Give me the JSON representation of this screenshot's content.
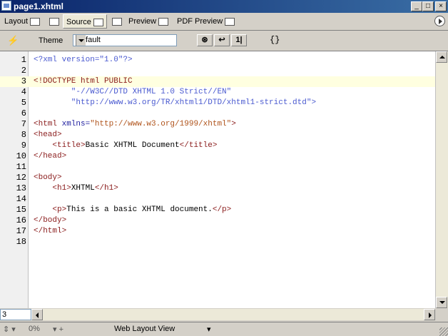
{
  "window": {
    "title": "page1.xhtml",
    "min_label": "_",
    "max_label": "□",
    "close_label": "×"
  },
  "tabs": [
    {
      "label": "Layout"
    },
    {
      "label": ""
    },
    {
      "label": "Source"
    },
    {
      "label": ""
    },
    {
      "label": "Preview"
    },
    {
      "label": "PDF Preview"
    }
  ],
  "toolbar": {
    "lightning_glyph": "⚡",
    "theme_label": "Theme",
    "theme_value": "Default",
    "btn1_glyph": "⊛",
    "btn2_glyph": "↩",
    "btn3_glyph": "1|",
    "braces_glyph": "{}"
  },
  "editor": {
    "highlighted_line": 3,
    "lines": [
      {
        "n": "1",
        "tokens": [
          {
            "t": "<?xml version=\"1.0\"?>",
            "c": "#4a5ad0"
          }
        ]
      },
      {
        "n": "2",
        "tokens": []
      },
      {
        "n": "3",
        "tokens": [
          {
            "t": "<!DOCTYPE html PUBLIC",
            "c": "#8a1c1c"
          }
        ]
      },
      {
        "n": "4",
        "tokens": [
          {
            "t": "        \"-//W3C//DTD XHTML 1.0 Strict//EN\"",
            "c": "#4a5ad0"
          }
        ]
      },
      {
        "n": "5",
        "tokens": [
          {
            "t": "        \"http://www.w3.org/TR/xhtml1/DTD/xhtml1-strict.dtd\">",
            "c": "#4a5ad0"
          }
        ]
      },
      {
        "n": "6",
        "tokens": []
      },
      {
        "n": "7",
        "tokens": [
          {
            "t": "<html ",
            "c": "#8a1c1c"
          },
          {
            "t": "xmlns=",
            "c": "#2020a0"
          },
          {
            "t": "\"http://www.w3.org/1999/xhtml\"",
            "c": "#b0541c"
          },
          {
            "t": ">",
            "c": "#8a1c1c"
          }
        ]
      },
      {
        "n": "8",
        "tokens": [
          {
            "t": "<head>",
            "c": "#8a1c1c"
          }
        ]
      },
      {
        "n": "9",
        "tokens": [
          {
            "t": "    <title>",
            "c": "#8a1c1c"
          },
          {
            "t": "Basic XHTML Document",
            "c": "#000000"
          },
          {
            "t": "</title>",
            "c": "#8a1c1c"
          }
        ]
      },
      {
        "n": "10",
        "tokens": [
          {
            "t": "</head>",
            "c": "#8a1c1c"
          }
        ]
      },
      {
        "n": "11",
        "tokens": []
      },
      {
        "n": "12",
        "tokens": [
          {
            "t": "<body>",
            "c": "#8a1c1c"
          }
        ]
      },
      {
        "n": "13",
        "tokens": [
          {
            "t": "    <h1>",
            "c": "#8a1c1c"
          },
          {
            "t": "XHTML",
            "c": "#000000"
          },
          {
            "t": "</h1>",
            "c": "#8a1c1c"
          }
        ]
      },
      {
        "n": "14",
        "tokens": []
      },
      {
        "n": "15",
        "tokens": [
          {
            "t": "    <p>",
            "c": "#8a1c1c"
          },
          {
            "t": "This is a basic XHTML document.",
            "c": "#000000"
          },
          {
            "t": "</p>",
            "c": "#8a1c1c"
          }
        ]
      },
      {
        "n": "16",
        "tokens": [
          {
            "t": "</body>",
            "c": "#8a1c1c"
          }
        ]
      },
      {
        "n": "17",
        "tokens": [
          {
            "t": "</html>",
            "c": "#8a1c1c"
          }
        ]
      },
      {
        "n": "18",
        "tokens": []
      }
    ]
  },
  "bottom": {
    "line_number": "3"
  },
  "statusbar": {
    "zoom": "0%",
    "view_mode": "Web Layout View"
  }
}
